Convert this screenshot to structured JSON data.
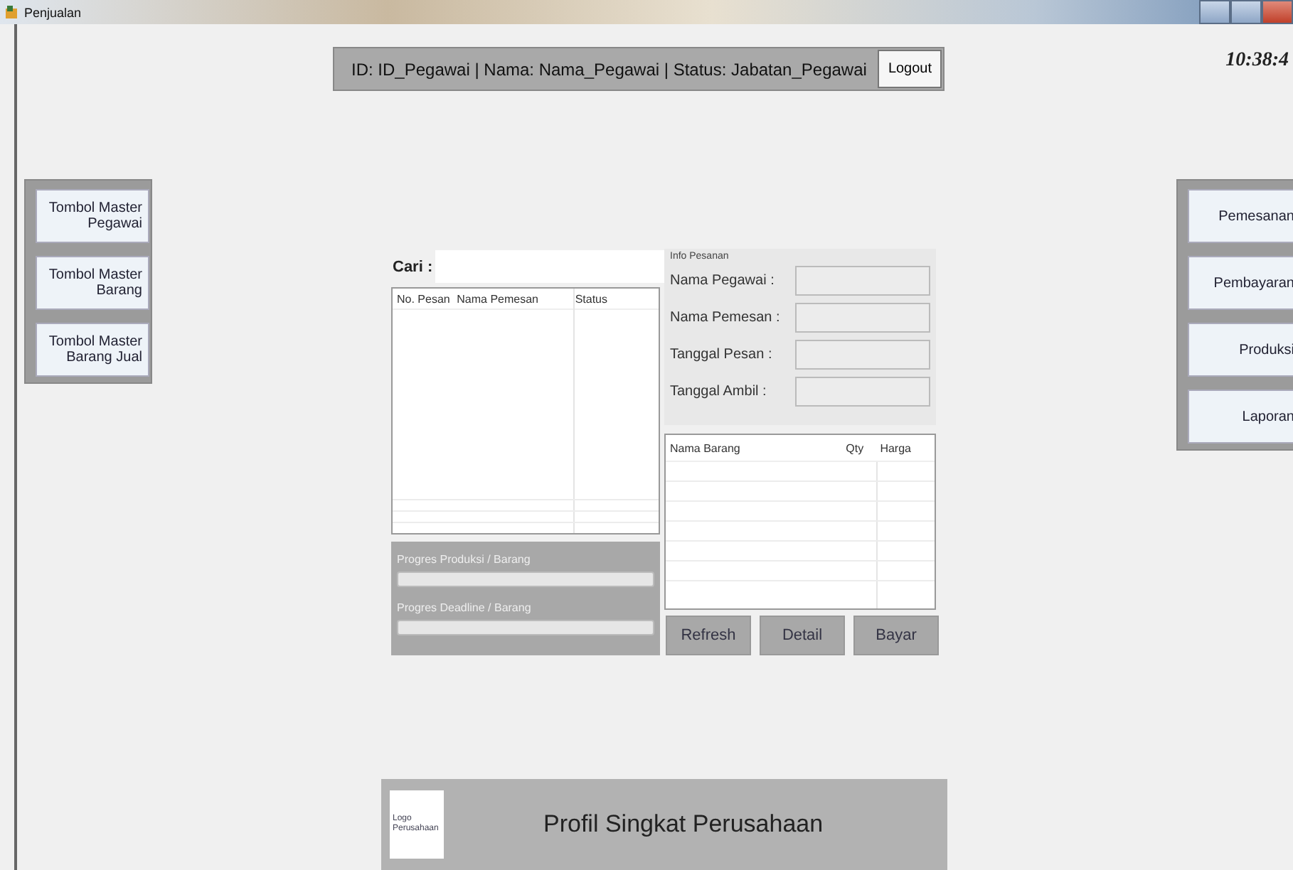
{
  "window": {
    "title": "Penjualan"
  },
  "header": {
    "user_info": "ID: ID_Pegawai | Nama: Nama_Pegawai | Status: Jabatan_Pegawai",
    "logout_button": "Logout"
  },
  "clock": "10:38:4",
  "left_menu": [
    "Tombol Master Pegawai",
    "Tombol Master Barang",
    "Tombol Master Barang Jual"
  ],
  "right_menu": [
    "Pemesanan",
    "Pembayaran",
    "Produksi",
    "Laporan"
  ],
  "search": {
    "label": "Cari :"
  },
  "orders_table": {
    "columns": [
      "No. Pesan",
      "Nama Pemesan",
      "Status"
    ]
  },
  "progress": [
    {
      "label": "Progres Produksi / Barang",
      "level": 0
    },
    {
      "label": "Progres Deadline / Barang",
      "level": 0
    }
  ],
  "order_info": {
    "title": "Info Pesanan",
    "fields": [
      {
        "label": "Nama Pegawai :"
      },
      {
        "label": "Nama Pemesan :"
      },
      {
        "label": "Tanggal Pesan :"
      },
      {
        "label": "Tanggal Ambil :"
      }
    ]
  },
  "items_table": {
    "columns": [
      "Nama Barang",
      "Qty",
      "Harga"
    ]
  },
  "actions": [
    "Refresh",
    "Detail",
    "Bayar"
  ],
  "footer": {
    "logo": "Logo Perusahaan",
    "profile": "Profil Singkat Perusahaan"
  }
}
